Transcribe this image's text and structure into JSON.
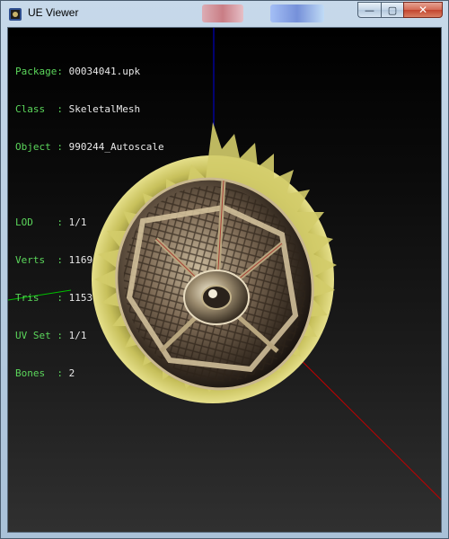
{
  "window": {
    "title": "UE Viewer",
    "controls": {
      "minimize": "—",
      "maximize": "▢",
      "close": "✕"
    }
  },
  "info": {
    "package": {
      "label": "Package:",
      "value": "00034041.upk"
    },
    "class": {
      "label": "Class  :",
      "value": "SkeletalMesh"
    },
    "object": {
      "label": "Object :",
      "value": "990244_Autoscale"
    },
    "lod": {
      "label": "LOD    :",
      "value": "1/1"
    },
    "verts": {
      "label": "Verts  :",
      "value": "1169"
    },
    "tris": {
      "label": "Tris   :",
      "value": "1153"
    },
    "uvset": {
      "label": "UV Set :",
      "value": "1/1"
    },
    "bones": {
      "label": "Bones  :",
      "value": "2"
    }
  },
  "colors": {
    "label_green": "#5bd65b",
    "axis_x": "#c00000",
    "axis_y": "#00c000",
    "axis_z": "#0000dd"
  },
  "icons": [
    "app-icon",
    "minimize-icon",
    "maximize-icon",
    "close-icon"
  ]
}
